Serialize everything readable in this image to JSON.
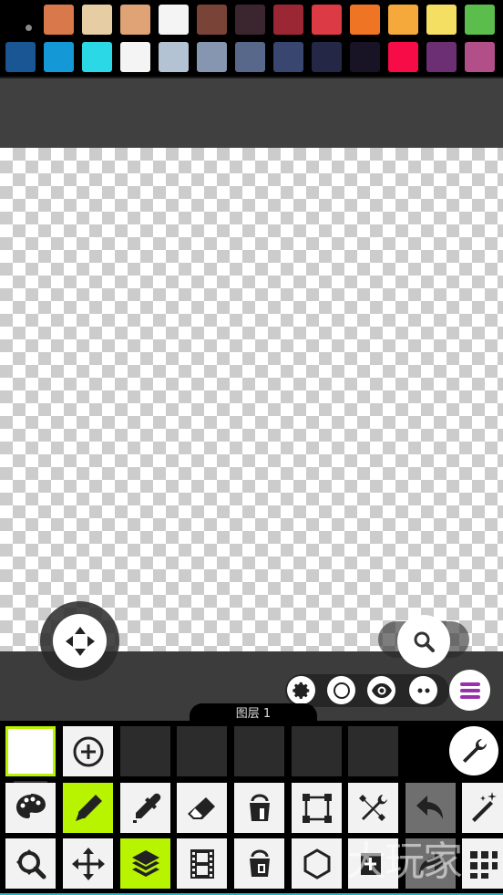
{
  "palette": {
    "row1": [
      "#d9784a",
      "#e6cda3",
      "#e0a375",
      "#f4f4f4",
      "#7a4338",
      "#3b2630",
      "#9c2734",
      "#dc3a45",
      "#ef7424",
      "#f5a93a",
      "#f5df63",
      "#5bbd4c"
    ],
    "row2": [
      "#1a5694",
      "#1598d6",
      "#2bd9e6",
      "#f4f4f4",
      "#b4c3d4",
      "#8696b0",
      "#58688a",
      "#384670",
      "#242746",
      "#191425",
      "#f80c47",
      "#6d2f73",
      "#b24e88"
    ]
  },
  "layer_tab": {
    "label": "图层 1"
  },
  "watermark": {
    "text": "大玩家"
  },
  "colors": {
    "accent": "#b8f400",
    "band": "#404040",
    "panel": "#000000"
  },
  "icons": {
    "move_joystick": "four-arrows-icon",
    "zoom": "magnifier-icon",
    "quick": [
      "gear-icon",
      "circle-icon",
      "eye-icon",
      "dots-icon",
      "menu-icon"
    ],
    "wrench": "wrench-icon",
    "tools_row1": [
      "palette-icon",
      "pencil-icon",
      "eyedropper-icon",
      "eraser-icon",
      "bucket-icon",
      "select-icon",
      "tools-icon",
      "undo-icon",
      "magic-wand-icon"
    ],
    "tools_row2": [
      "zoom-tool-icon",
      "move-icon",
      "layers-icon",
      "film-icon",
      "bucket-alt-icon",
      "hexagon-icon",
      "add-frame-icon",
      "redo-icon",
      "grid-icon"
    ]
  }
}
